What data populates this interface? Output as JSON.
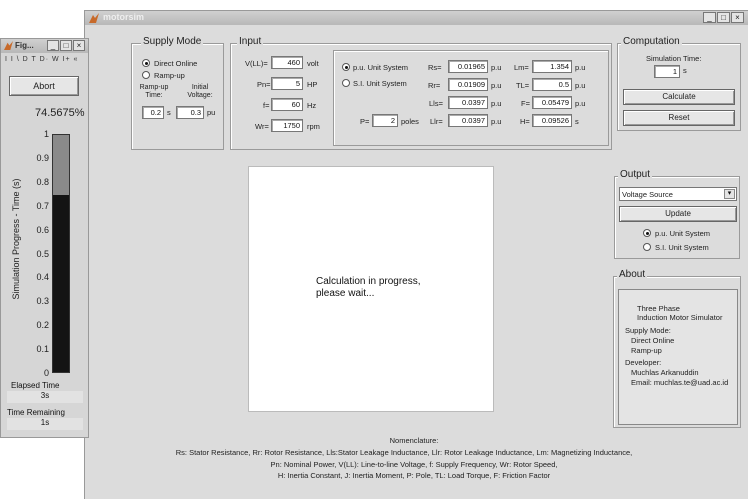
{
  "main_window": {
    "title": "motorsim"
  },
  "progress_window": {
    "title": "Fig...",
    "menu": "I I \\ D T D· W I+ «",
    "abort_label": "Abort",
    "percent": "74.5675%",
    "progress_fraction": 0.745675,
    "y_ticks": [
      "1",
      "0.9",
      "0.8",
      "0.7",
      "0.6",
      "0.5",
      "0.4",
      "0.3",
      "0.2",
      "0.1",
      "0"
    ],
    "ylabel": "Simulation Progress - Time (s)",
    "elapsed_label": "Elapsed Time",
    "elapsed_value": "3s",
    "remaining_label": "Time Remaining",
    "remaining_value": "1s"
  },
  "supply_mode": {
    "title": "Supply Mode",
    "direct_online_label": "Direct Online",
    "ramp_up_label": "Ramp-up",
    "selected": "direct_online",
    "ramp_time_label": "Ramp-up Time:",
    "initial_voltage_label": "Initial Voltage:",
    "ramp_time_value": "0.2",
    "ramp_time_unit": "s",
    "initial_voltage_value": "0.3",
    "initial_voltage_unit": "pu"
  },
  "input": {
    "title": "Input",
    "vll_label": "V(LL)=",
    "vll_value": "460",
    "vll_unit": "volt",
    "pn_label": "Pn=",
    "pn_value": "5",
    "pn_unit": "HP",
    "f_label": "f=",
    "f_value": "60",
    "f_unit": "Hz",
    "wr_label": "Wr=",
    "wr_value": "1750",
    "wr_unit": "rpm",
    "pu_system_label": "p.u. Unit System",
    "si_system_label": "S.I. Unit System",
    "unit_selected": "pu",
    "rs_label": "Rs=",
    "rs_value": "0.01965",
    "rs_unit": "p.u",
    "rr_label": "Rr=",
    "rr_value": "0.01909",
    "rr_unit": "p.u",
    "lls_label": "Lls=",
    "lls_value": "0.0397",
    "lls_unit": "p.u",
    "llr_label": "Llr=",
    "llr_value": "0.0397",
    "llr_unit": "p.u",
    "lm_label": "Lm=",
    "lm_value": "1.354",
    "lm_unit": "p.u",
    "tl_label": "TL=",
    "tl_value": "0.5",
    "tl_unit": "p.u",
    "fr_label": "F=",
    "fr_value": "0.05479",
    "fr_unit": "p.u",
    "h_label": "H=",
    "h_value": "0.09526",
    "h_unit": "s",
    "p_label": "P=",
    "p_value": "2",
    "p_unit": "poles"
  },
  "computation": {
    "title": "Computation",
    "sim_time_label": "Simulation Time:",
    "sim_time_value": "1",
    "sim_time_unit": "s",
    "calculate_label": "Calculate",
    "reset_label": "Reset"
  },
  "output": {
    "title": "Output",
    "select_value": "Voltage Source",
    "update_label": "Update",
    "pu_label": "p.u. Unit System",
    "si_label": "S.I. Unit System",
    "selected": "pu"
  },
  "about": {
    "title": "About",
    "line1": "Three Phase",
    "line2": "Induction Motor Simulator",
    "line3": "Supply Mode:",
    "line4": "Direct Online",
    "line5": "Ramp-up",
    "line6": "Developer:",
    "line7": "Muchlas Arkanuddin",
    "line8": "Email: muchlas.te@uad.ac.id"
  },
  "status": {
    "line1": "Calculation in progress,",
    "line2": "please wait..."
  },
  "nomenclature": {
    "title": "Nomenclature:",
    "line1": "Rs: Stator Resistance, Rr: Rotor Resistance, Lls:Stator Leakage Inductance, Llr: Rotor Leakage Inductance, Lm: Magnetizing Inductance,",
    "line2": "Pn: Nominal Power, V(LL): Line-to-line Voltage, f: Supply Frequency, Wr: Rotor Speed,",
    "line3": "H: Inertia Constant, J: Inertia Moment, P: Pole, TL: Load Torque, F: Friction Factor"
  },
  "colors": {
    "bar_fill": "#141414",
    "bar_remaining": "#8a8a8a",
    "window_bg": "#dcdcdc"
  }
}
